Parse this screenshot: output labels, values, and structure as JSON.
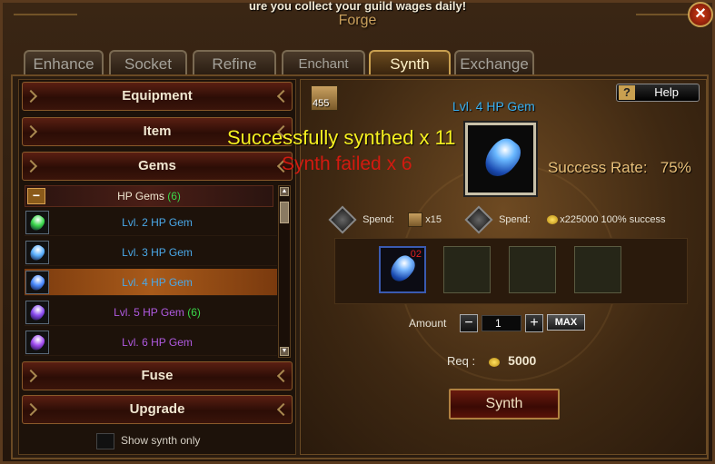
{
  "banner": "ure you collect your guild wages daily!",
  "window_title": "Forge",
  "close_symbol": "✕",
  "tabs": [
    {
      "label": "Enhance",
      "active": false
    },
    {
      "label": "Socket",
      "active": false
    },
    {
      "label": "Refine",
      "active": false
    },
    {
      "label": "Enchant",
      "active": false
    },
    {
      "label": "Synth",
      "active": true
    },
    {
      "label": "Exchange",
      "active": false
    }
  ],
  "categories": {
    "equipment": "Equipment",
    "item": "Item",
    "gems": "Gems",
    "fuse": "Fuse",
    "upgrade": "Upgrade"
  },
  "gem_list": {
    "header_name": "HP Gems",
    "header_count": "(6)",
    "collapse_symbol": "−",
    "rows": [
      {
        "name": "Lvl. 2 HP Gem",
        "count": "",
        "color": "#4aa8e8",
        "gem_color": "#3ad84a",
        "selected": false
      },
      {
        "name": "Lvl. 3 HP Gem",
        "count": "",
        "color": "#4aa8e8",
        "gem_color": "#5ab0ff",
        "selected": false
      },
      {
        "name": "Lvl. 4 HP Gem",
        "count": "",
        "color": "#4aa8e8",
        "gem_color": "#4a8aff",
        "selected": true
      },
      {
        "name": "Lvl. 5 HP Gem",
        "count": "(6)",
        "color": "#b05ae0",
        "gem_color": "#8a4af0",
        "selected": false
      },
      {
        "name": "Lvl. 6 HP Gem",
        "count": "",
        "color": "#b05ae0",
        "gem_color": "#a04af0",
        "selected": false
      }
    ]
  },
  "show_synth_only": "Show synth only",
  "bag_count": "455",
  "help_label": "Help",
  "help_symbol": "?",
  "target_gem": "Lvl. 4 HP Gem",
  "messages": {
    "success": "Successfully synthed x 11",
    "failed": "Synth failed x 6"
  },
  "success_rate_label": "Success Rate:",
  "success_rate_value": "75%",
  "spend": [
    {
      "label": "Spend:",
      "value": "x15"
    },
    {
      "label": "Spend:",
      "value": "x225000 100% success"
    }
  ],
  "slots": {
    "filled_qty": "02"
  },
  "amount": {
    "label": "Amount",
    "value": "1",
    "minus": "−",
    "plus": "+",
    "max_label": "MAX"
  },
  "req": {
    "label": "Req :",
    "value": "5000"
  },
  "synth_button": "Synth"
}
